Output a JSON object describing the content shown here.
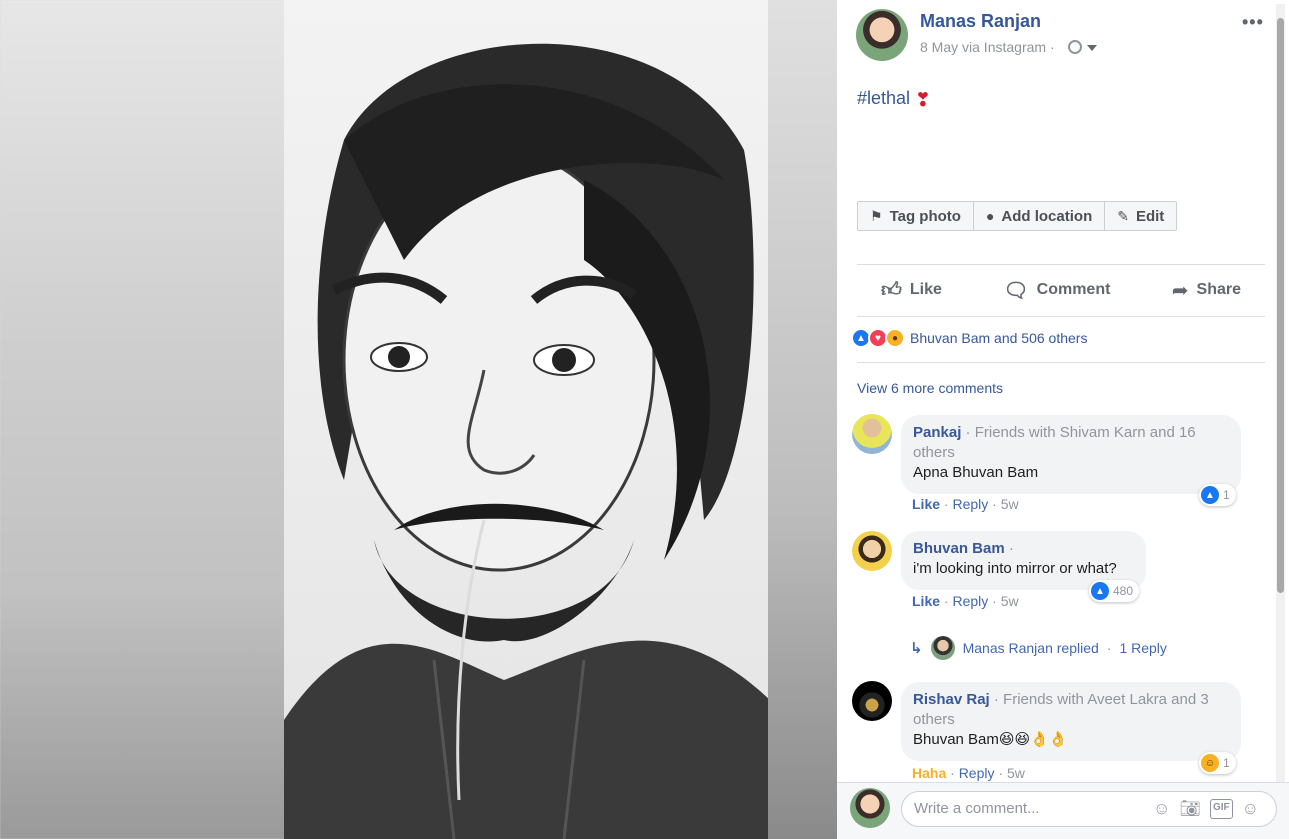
{
  "post": {
    "author": "Manas Ranjan",
    "meta": "8 May via Instagram ·",
    "caption": "#lethal",
    "caption_emoji": "❣",
    "more": "•••"
  },
  "photo_actions": [
    {
      "icon": "tag-icon",
      "label": "Tag photo"
    },
    {
      "icon": "location-pin-icon",
      "label": "Add location"
    },
    {
      "icon": "pencil-icon",
      "label": "Edit"
    }
  ],
  "actions": {
    "like": "Like",
    "comment": "Comment",
    "share": "Share"
  },
  "reactions": {
    "summary": "Bhuvan Bam and 506 others",
    "types": [
      "like",
      "love",
      "wow"
    ]
  },
  "view_more": "View 6 more comments",
  "comments": [
    {
      "name": "Pankaj",
      "meta": " · Friends with Shivam Karn and 16 others",
      "text": "Apna Bhuvan Bam",
      "like_label": "Like",
      "reply_label": "Reply",
      "time": "5w",
      "reaction_count": "1"
    },
    {
      "name": "Bhuvan Bam",
      "meta": " ·",
      "text": "i'm looking into mirror or what?",
      "like_label": "Like",
      "reply_label": "Reply",
      "time": "5w",
      "reaction_count": "480"
    },
    {
      "name": "Rishav Raj",
      "meta": " · Friends with Aveet Lakra and 3 others",
      "text": "Bhuvan Bam😆😆👌👌",
      "like_label": "Haha",
      "reply_label": "Reply",
      "time": "5w",
      "reaction_count": "1"
    }
  ],
  "reply_thread": {
    "text": "Manas Ranjan replied",
    "count": "1 Reply"
  },
  "write": {
    "placeholder": "Write a comment...",
    "icons": [
      "emoji-icon",
      "camera-icon",
      "gif-icon",
      "sticker-icon"
    ],
    "gif_label": "GIF"
  },
  "colors": {
    "link": "#365899",
    "accent": "#4267b2",
    "muted": "#90949c"
  }
}
